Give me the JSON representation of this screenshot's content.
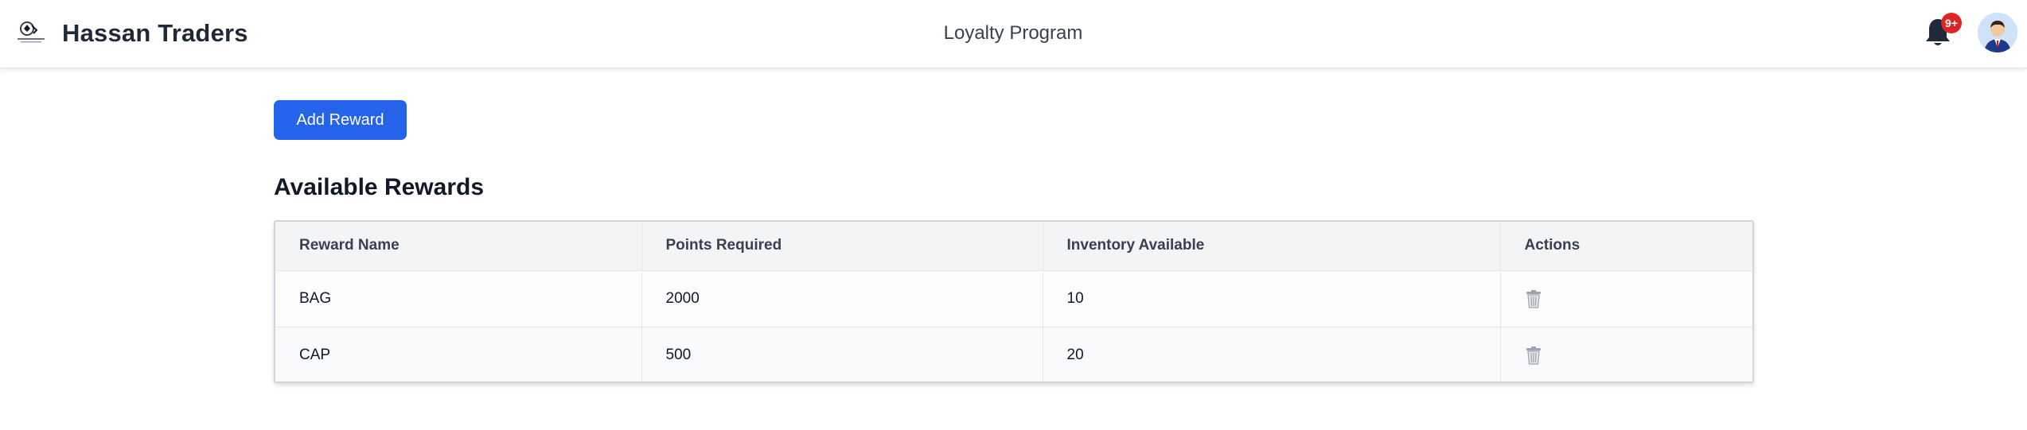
{
  "header": {
    "brand": "Hassan Traders",
    "page_title": "Loyalty Program",
    "notification_badge": "9+",
    "icons": {
      "logo": "company-logo",
      "notifications": "bell-icon",
      "profile": "avatar"
    }
  },
  "toolbar": {
    "add_reward_label": "Add Reward"
  },
  "rewards": {
    "title": "Available Rewards",
    "columns": [
      "Reward Name",
      "Points Required",
      "Inventory Available",
      "Actions"
    ],
    "rows": [
      {
        "name": "BAG",
        "points": "2000",
        "inventory": "10",
        "action_icon": "trash-icon"
      },
      {
        "name": "CAP",
        "points": "500",
        "inventory": "20",
        "action_icon": "trash-icon"
      }
    ]
  },
  "colors": {
    "primary": "#2563eb",
    "badge": "#dc2626",
    "text_dark": "#1f2937",
    "table_header_bg": "#f3f4f6"
  }
}
